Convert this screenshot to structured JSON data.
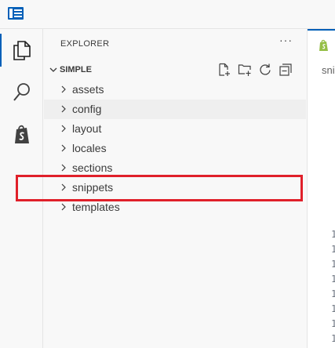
{
  "titlebar": {
    "app_icon": "vscode-layout-icon"
  },
  "activity_bar": {
    "items": [
      {
        "icon": "files-icon",
        "active": true
      },
      {
        "icon": "search-icon",
        "active": false
      },
      {
        "icon": "shopify-icon",
        "active": false
      }
    ]
  },
  "explorer": {
    "title": "EXPLORER",
    "more_label": "···",
    "folder": {
      "name": "SIMPLE",
      "actions": [
        "new-file-icon",
        "new-folder-icon",
        "refresh-icon",
        "collapse-all-icon"
      ],
      "items": [
        {
          "label": "assets"
        },
        {
          "label": "config"
        },
        {
          "label": "layout"
        },
        {
          "label": "locales"
        },
        {
          "label": "sections"
        },
        {
          "label": "snippets"
        },
        {
          "label": "templates"
        }
      ]
    }
  },
  "editor": {
    "tab_icon": "shopify-icon",
    "breadcrumb": "sni",
    "line_numbers": [
      "1",
      "1",
      "1",
      "1",
      "1",
      "1",
      "1",
      "1"
    ]
  },
  "colors": {
    "accent": "#005fb8",
    "highlight": "#e0202a",
    "shopify": "#95bf47"
  }
}
